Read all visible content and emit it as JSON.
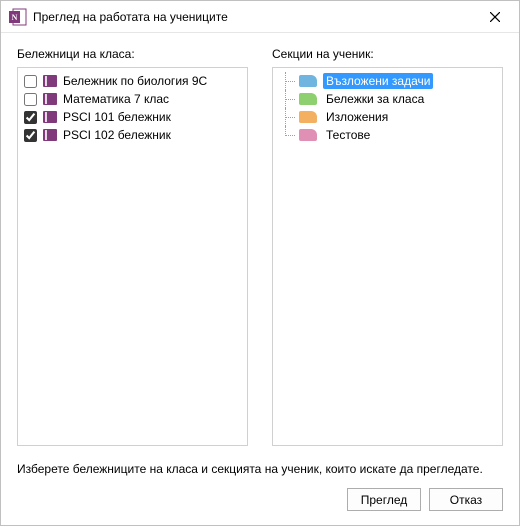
{
  "window": {
    "title": "Преглед на работата на учениците"
  },
  "labels": {
    "notebooks": "Бележници на класа:",
    "sections": "Секции на ученик:",
    "hint": "Изберете бележниците на класа и секцията на ученик, които искате да прегледате."
  },
  "notebooks": [
    {
      "label": "Бележник по биология 9C",
      "checked": false
    },
    {
      "label": "Математика 7 клас",
      "checked": false
    },
    {
      "label": "PSCI 101 бележник",
      "checked": true
    },
    {
      "label": "PSCI 102 бележник",
      "checked": true
    }
  ],
  "sections": [
    {
      "label": "Възложени задачи",
      "color": "#6fb5e0",
      "selected": true
    },
    {
      "label": "Бележки за класа",
      "color": "#8ecf6f",
      "selected": false
    },
    {
      "label": "Изложения",
      "color": "#f2b060",
      "selected": false
    },
    {
      "label": "Тестове",
      "color": "#e08fb5",
      "selected": false
    }
  ],
  "buttons": {
    "review": "Преглед",
    "cancel": "Отказ"
  }
}
